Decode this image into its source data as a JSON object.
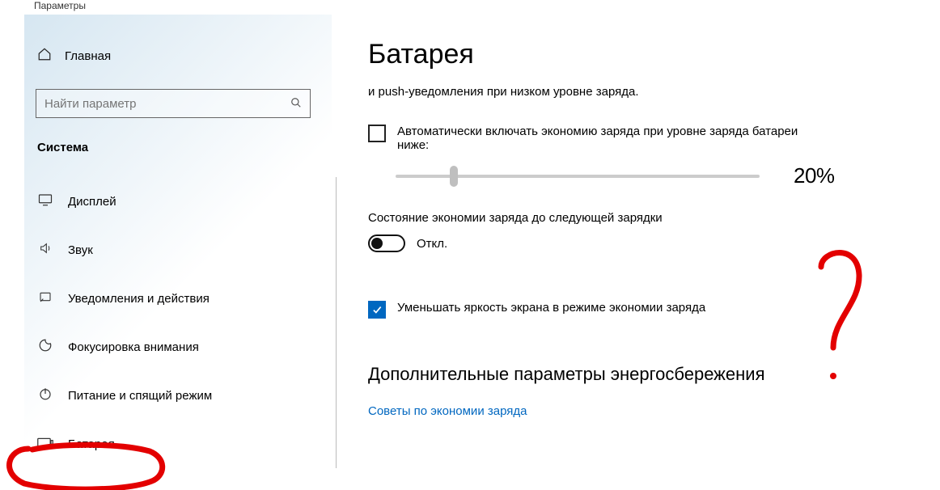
{
  "window": {
    "title": "Параметры"
  },
  "sidebar": {
    "home_label": "Главная",
    "search_placeholder": "Найти параметр",
    "group_label": "Система",
    "items": [
      {
        "icon": "display-icon",
        "label": "Дисплей"
      },
      {
        "icon": "sound-icon",
        "label": "Звук"
      },
      {
        "icon": "notify-icon",
        "label": "Уведомления и действия"
      },
      {
        "icon": "focus-icon",
        "label": "Фокусировка внимания"
      },
      {
        "icon": "power-icon",
        "label": "Питание и спящий режим"
      },
      {
        "icon": "battery-icon",
        "label": "Батарея"
      }
    ],
    "selected_index": 5
  },
  "main": {
    "title": "Батарея",
    "subline": "и push-уведомления при низком уровне заряда.",
    "auto_saver_checkbox_label": "Автоматически включать экономию заряда при уровне заряда батареи ниже:",
    "slider_value_label": "20%",
    "slider_value": 20,
    "status_saver_label": "Состояние экономии заряда до следующей зарядки",
    "toggle_state_label": "Откл.",
    "dim_checkbox_label": "Уменьшать яркость экрана в режиме экономии заряда",
    "section_header": "Дополнительные параметры энергосбережения",
    "link_label": "Советы по экономии заряда"
  }
}
